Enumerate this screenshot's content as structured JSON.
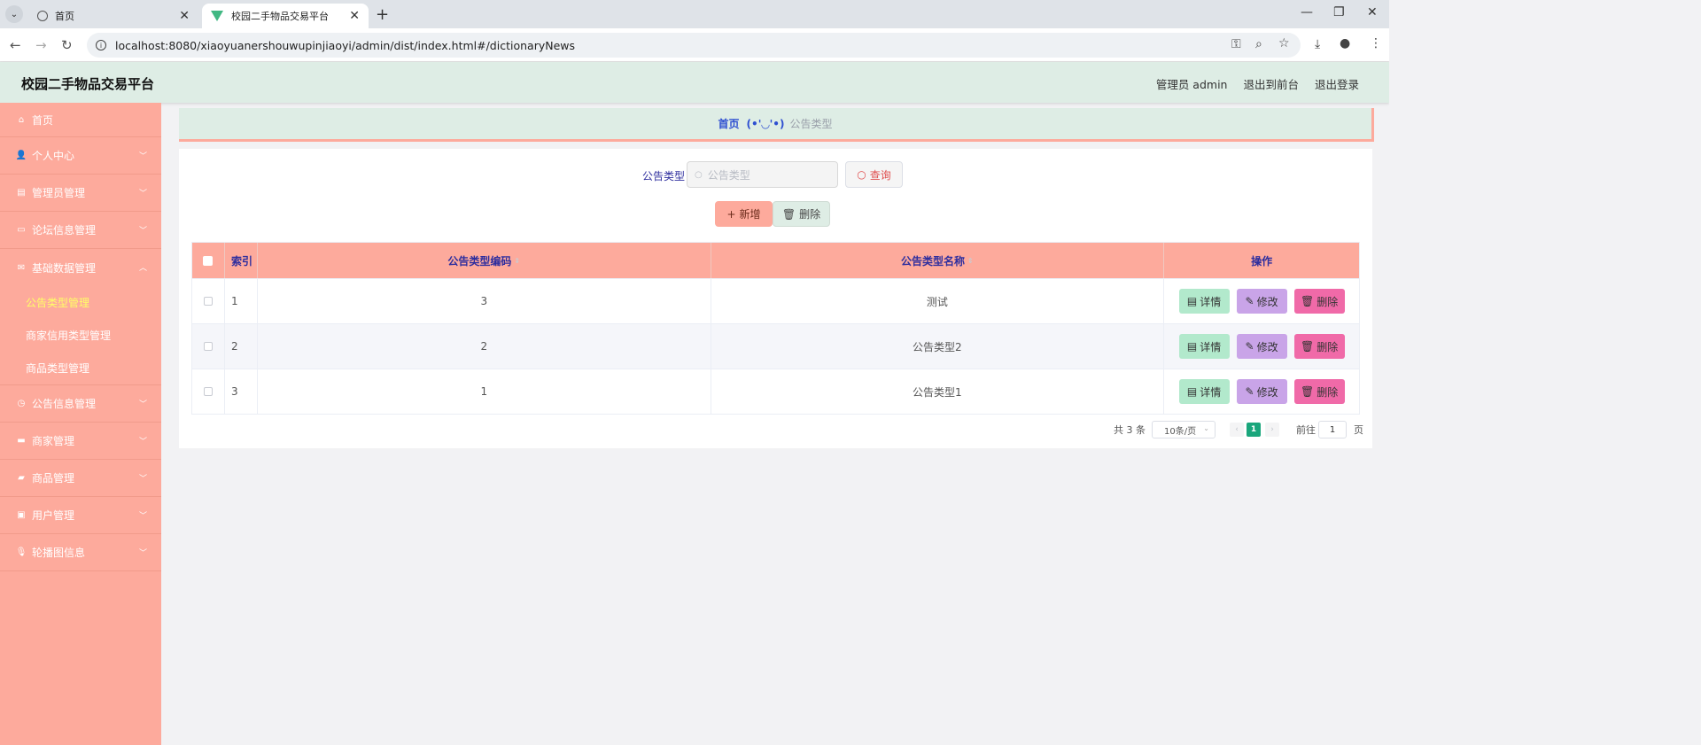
{
  "browser": {
    "tabs": [
      {
        "title": "首页"
      },
      {
        "title": "校园二手物品交易平台"
      }
    ],
    "url": "localhost:8080/xiaoyuanershouwupinjiaoyi/admin/dist/index.html#/dictionaryNews"
  },
  "header": {
    "title": "校园二手物品交易平台",
    "admin_label": "管理员 admin",
    "to_front": "退出到前台",
    "logout": "退出登录"
  },
  "sidebar": {
    "items": [
      {
        "label": "首页",
        "icon": "home-icon"
      },
      {
        "label": "个人中心",
        "icon": "user-icon"
      },
      {
        "label": "管理员管理",
        "icon": "chart-icon"
      },
      {
        "label": "论坛信息管理",
        "icon": "card-icon"
      },
      {
        "label": "基础数据管理",
        "icon": "mail-icon"
      },
      {
        "label": "公告信息管理",
        "icon": "clock-icon"
      },
      {
        "label": "商家管理",
        "icon": "shop-icon"
      },
      {
        "label": "商品管理",
        "icon": "goods-icon"
      },
      {
        "label": "用户管理",
        "icon": "briefcase-icon"
      },
      {
        "label": "轮播图信息",
        "icon": "mic-icon"
      }
    ],
    "sub_items": [
      {
        "label": "公告类型管理",
        "active": true
      },
      {
        "label": "商家信用类型管理",
        "active": false
      },
      {
        "label": "商品类型管理",
        "active": false
      }
    ]
  },
  "breadcrumb": {
    "home": "首页",
    "face": "(•'◡'•)",
    "current": "公告类型"
  },
  "search": {
    "label": "公告类型",
    "placeholder": "公告类型",
    "button": "查询"
  },
  "actions": {
    "add": "新增",
    "delete": "删除"
  },
  "table": {
    "headers": [
      "索引",
      "公告类型编码",
      "公告类型名称",
      "操作"
    ],
    "rows": [
      {
        "index": "1",
        "code": "3",
        "name": "测试"
      },
      {
        "index": "2",
        "code": "2",
        "name": "公告类型2"
      },
      {
        "index": "3",
        "code": "1",
        "name": "公告类型1"
      }
    ],
    "row_actions": {
      "detail": "详情",
      "edit": "修改",
      "delete": "删除"
    }
  },
  "pagination": {
    "total": "共 3 条",
    "page_size": "10条/页",
    "current_page": "1",
    "goto_label": "前往",
    "goto_value": "1",
    "page_label": "页"
  },
  "colors": {
    "sidebar": "#fdaa9c",
    "header": "#deede5",
    "accent_green": "#1aa67c"
  }
}
